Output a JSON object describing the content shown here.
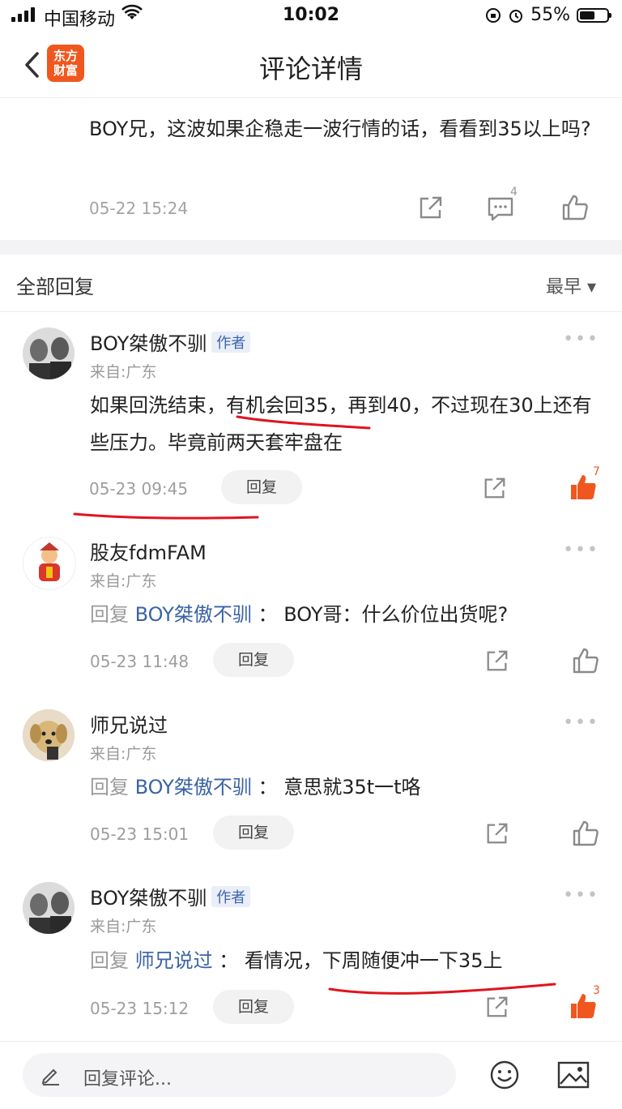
{
  "status": {
    "carrier": "中国移动",
    "time": "10:02",
    "battery": "55%",
    "battery_level": 0.55
  },
  "nav": {
    "title": "评论详情",
    "logo": [
      "东方",
      "财富"
    ]
  },
  "post": {
    "text": "BOY兄，这波如果企稳走一波行情的话，看看到35以上吗?",
    "time": "05-22 15:24",
    "comment_count": "4"
  },
  "replies_header": {
    "label": "全部回复",
    "sort": "最早 ▾"
  },
  "comments": [
    {
      "name": "BOY桀傲不驯",
      "tag": "作者",
      "from": "来自:广东",
      "body": "如果回洗结束，有机会回35，再到40，不过现在30上还有些压力。毕竟前两天套牢盘在",
      "time": "05-23 09:45",
      "reply": "回复",
      "likes": "7"
    },
    {
      "name": "股友fdmFAM",
      "from": "来自:广东",
      "reply_prefix": "回复",
      "reply_to": "BOY桀傲不驯",
      "sep": "：",
      "body": "BOY哥：什么价位出货呢?",
      "time": "05-23 11:48",
      "reply": "回复"
    },
    {
      "name": "师兄说过",
      "from": "来自:广东",
      "reply_prefix": "回复",
      "reply_to": "BOY桀傲不驯",
      "sep": "：",
      "body": "意思就35t一t咯",
      "time": "05-23 15:01",
      "reply": "回复"
    },
    {
      "name": "BOY桀傲不驯",
      "tag": "作者",
      "from": "来自:广东",
      "reply_prefix": "回复",
      "reply_to": "师兄说过",
      "sep": "：",
      "body": "看情况，下周随便冲一下35上",
      "time": "05-23 15:12",
      "reply": "回复",
      "likes": "3"
    }
  ],
  "input": {
    "placeholder": "回复评论..."
  },
  "colors": {
    "accent": "#f0571e",
    "link": "#3b62a6",
    "annotation": "#e0141e"
  },
  "icons": [
    "back-arrow-icon",
    "share-icon",
    "comment-icon",
    "thumb-up-icon",
    "edit-icon",
    "emoji-icon",
    "image-icon"
  ]
}
